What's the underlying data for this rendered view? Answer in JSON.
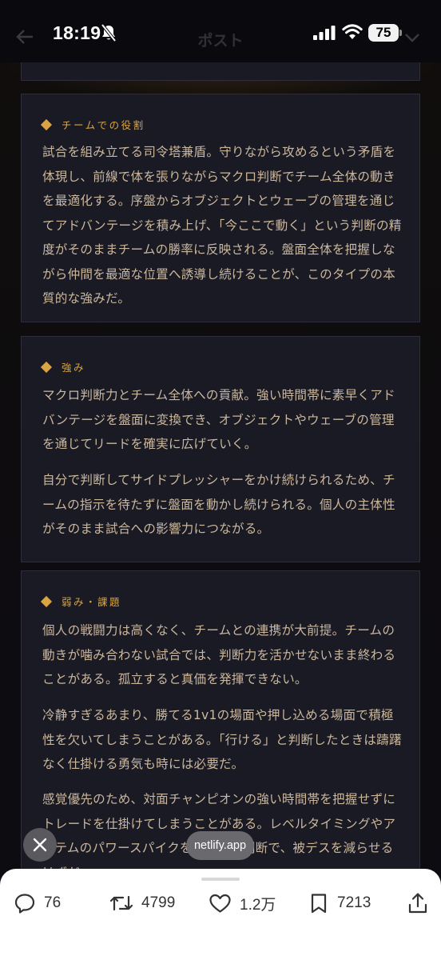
{
  "status_bar": {
    "time": "18:19",
    "battery": "75"
  },
  "nav": {
    "title": "ポスト"
  },
  "sections": [
    {
      "title": "チームでの役割",
      "paragraphs": [
        "試合を組み立てる司令塔兼盾。守りながら攻めるという矛盾を体現し、前線で体を張りながらマクロ判断でチーム全体の動きを最適化する。序盤からオブジェクトとウェーブの管理を通じてアドバンテージを積み上げ、「今ここで動く」という判断の精度がそのままチームの勝率に反映される。盤面全体を把握しながら仲間を最適な位置へ誘導し続けることが、このタイプの本質的な強みだ。"
      ]
    },
    {
      "title": "強み",
      "paragraphs": [
        "マクロ判断力とチーム全体への貢献。強い時間帯に素早くアドバンテージを盤面に変換でき、オブジェクトやウェーブの管理を通じてリードを確実に広げていく。",
        "自分で判断してサイドプレッシャーをかけ続けられるため、チームの指示を待たずに盤面を動かし続けられる。個人の主体性がそのまま試合への影響力につながる。"
      ]
    },
    {
      "title": "弱み・課題",
      "paragraphs": [
        "個人の戦闘力は高くなく、チームとの連携が大前提。チームの動きが噛み合わない試合では、判断力を活かせないまま終わることがある。孤立すると真価を発揮できない。",
        "冷静すぎるあまり、勝てる1v1の場面や押し込める場面で積極性を欠いてしまうことがある。「行ける」と判断したときは躊躇なく仕掛ける勇気も時には必要だ。",
        "感覚優先のため、対面チャンピオンの強い時間帯を把握せずにトレードを仕掛けてしまうことがある。レベルタイミングやアイテムのパワースパイクを意識した判断で、被デスを減らせるはずだ。"
      ]
    }
  ],
  "browser": {
    "domain": "netlify.app"
  },
  "actions": {
    "replies": "76",
    "reposts": "4799",
    "likes": "1.2万",
    "bookmarks": "7213"
  },
  "colors": {
    "accent": "#d9a441",
    "card_bg": "#1a1a24",
    "text": "#cbb79c"
  }
}
